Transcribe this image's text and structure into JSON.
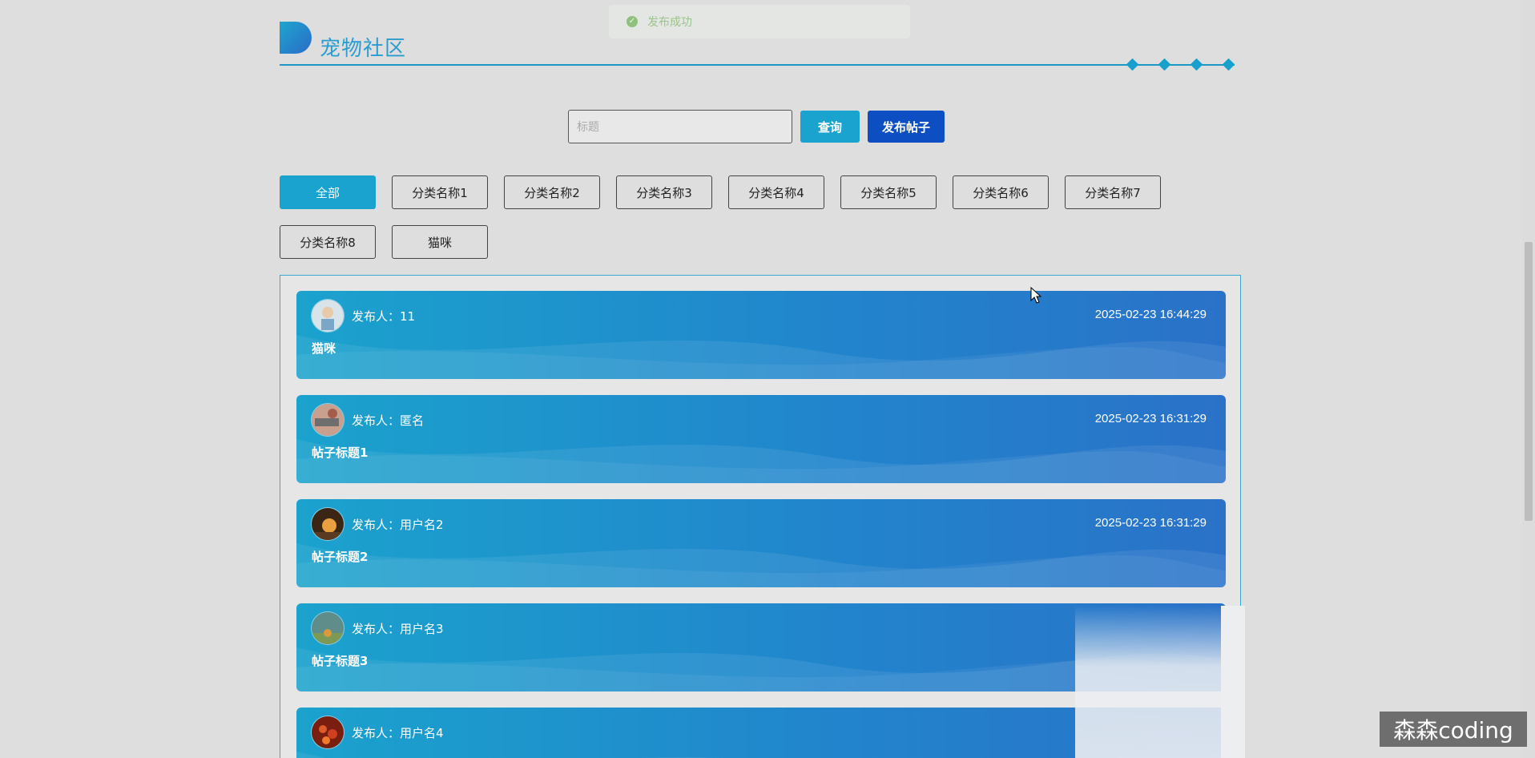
{
  "toast": {
    "message": "发布成功"
  },
  "header": {
    "title": "宠物社区"
  },
  "search": {
    "placeholder": "标题",
    "value": "",
    "query_label": "查询",
    "post_label": "发布帖子"
  },
  "categories": [
    {
      "label": "全部",
      "active": true
    },
    {
      "label": "分类名称1"
    },
    {
      "label": "分类名称2"
    },
    {
      "label": "分类名称3"
    },
    {
      "label": "分类名称4"
    },
    {
      "label": "分类名称5"
    },
    {
      "label": "分类名称6"
    },
    {
      "label": "分类名称7"
    },
    {
      "label": "分类名称8"
    },
    {
      "label": "猫咪"
    }
  ],
  "posts": [
    {
      "author_label": "发布人：11",
      "time": "2025-02-23 16:44:29",
      "title": "猫咪"
    },
    {
      "author_label": "发布人：匿名",
      "time": "2025-02-23 16:31:29",
      "title": "帖子标题1"
    },
    {
      "author_label": "发布人：用户名2",
      "time": "2025-02-23 16:31:29",
      "title": "帖子标题2"
    },
    {
      "author_label": "发布人：用户名3",
      "time": "",
      "title": "帖子标题3"
    },
    {
      "author_label": "发布人：用户名4",
      "time": "",
      "title": ""
    }
  ],
  "watermark": "森森coding",
  "colors": {
    "accent": "#1aa3cf",
    "primary": "#0d4fc2",
    "card_start": "#1ba2cd",
    "card_end": "#2a72c8"
  }
}
